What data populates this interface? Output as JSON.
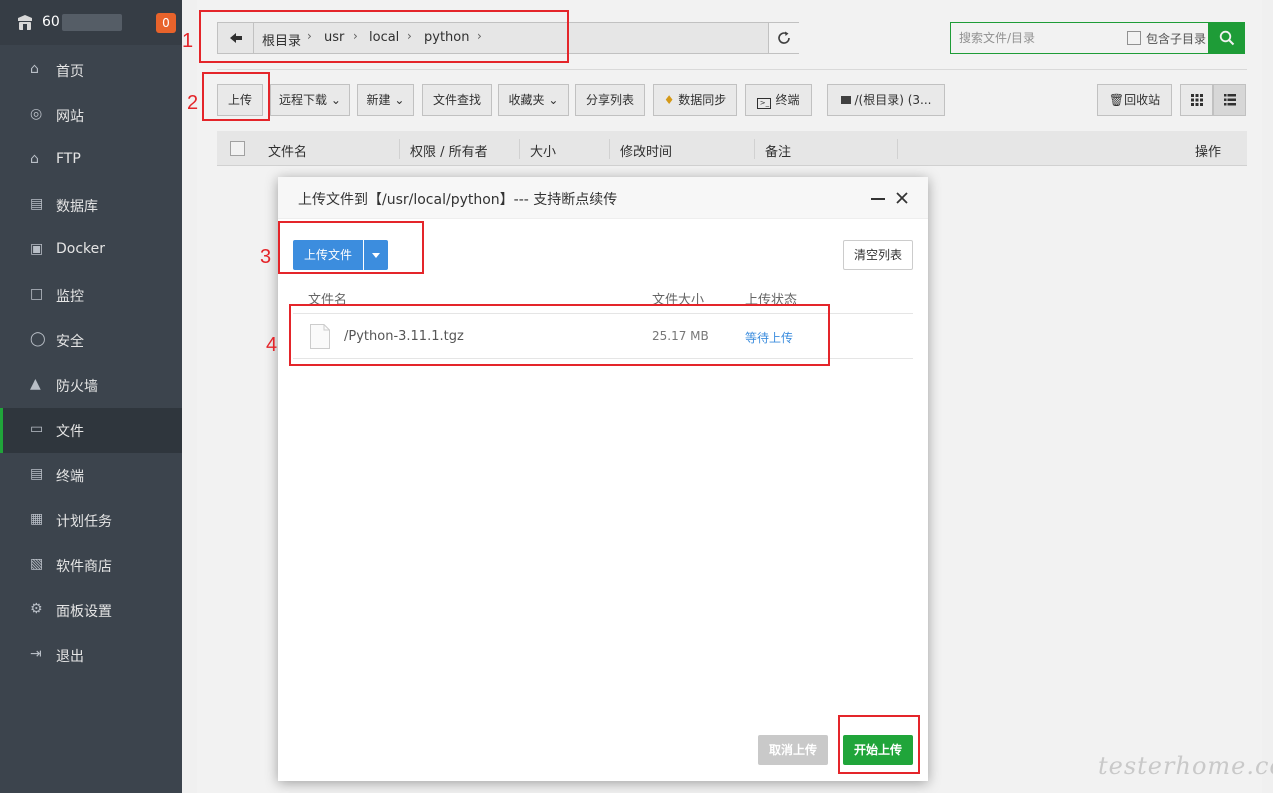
{
  "sidebar": {
    "host": "60",
    "badge": "0",
    "items": [
      {
        "label": "首页",
        "icon": "home-icon"
      },
      {
        "label": "网站",
        "icon": "globe-icon"
      },
      {
        "label": "FTP",
        "icon": "ftp-icon"
      },
      {
        "label": "数据库",
        "icon": "database-icon"
      },
      {
        "label": "Docker",
        "icon": "docker-icon"
      },
      {
        "label": "监控",
        "icon": "monitor-icon"
      },
      {
        "label": "安全",
        "icon": "shield-check-icon"
      },
      {
        "label": "防火墙",
        "icon": "firewall-icon"
      },
      {
        "label": "文件",
        "icon": "folder-icon",
        "active": true
      },
      {
        "label": "终端",
        "icon": "terminal-icon"
      },
      {
        "label": "计划任务",
        "icon": "calendar-icon"
      },
      {
        "label": "软件商店",
        "icon": "apps-icon"
      },
      {
        "label": "面板设置",
        "icon": "gear-icon"
      },
      {
        "label": "退出",
        "icon": "logout-icon"
      }
    ]
  },
  "breadcrumb": [
    "根目录",
    "usr",
    "local",
    "python"
  ],
  "search": {
    "placeholder": "搜索文件/目录",
    "include_sub_label": "包含子目录"
  },
  "toolbar": {
    "upload": "上传",
    "remote_download": "远程下载",
    "new": "新建",
    "find": "文件查找",
    "favorites": "收藏夹",
    "share_list": "分享列表",
    "data_sync": "数据同步",
    "terminal": "终端",
    "disk": "/(根目录) (3...",
    "recycle": "回收站"
  },
  "table_headers": [
    "文件名",
    "权限 / 所有者",
    "大小",
    "修改时间",
    "备注",
    "操作"
  ],
  "dialog": {
    "title": "上传文件到【/usr/local/python】--- 支持断点续传",
    "upload_file_button": "上传文件",
    "clear_list_button": "清空列表",
    "list_headers": {
      "name": "文件名",
      "size": "文件大小",
      "status": "上传状态"
    },
    "files": [
      {
        "name": "/Python-3.11.1.tgz",
        "size": "25.17 MB",
        "status": "等待上传"
      }
    ],
    "cancel_button": "取消上传",
    "start_button": "开始上传"
  },
  "annotations": [
    "1",
    "2",
    "3",
    "4"
  ],
  "watermark": "testerhome.com",
  "colors": {
    "accent_green": "#20a53a",
    "primary_blue": "#3c8dde",
    "annotation_red": "#e4252a",
    "sidebar_bg": "#3c444d"
  }
}
